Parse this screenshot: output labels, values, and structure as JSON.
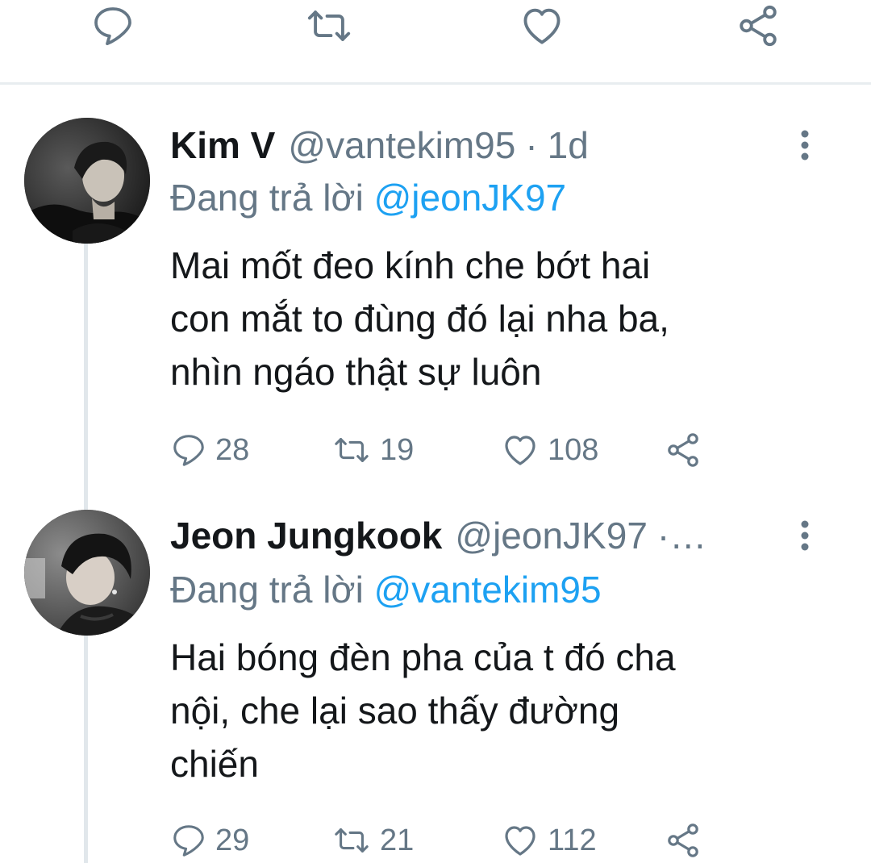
{
  "top_actions": {
    "reply_icon": "reply-icon",
    "retweet_icon": "retweet-icon",
    "like_icon": "heart-icon",
    "share_icon": "share-icon"
  },
  "tweets": [
    {
      "name": "Kim V",
      "handle": "@vantekim95",
      "separator": "·",
      "time": "1d",
      "replying_prefix": "Đang trả lời",
      "replying_to": "@jeonJK97",
      "text_lines": [
        "Mai mốt đeo kính che bớt hai",
        "con mắt to đùng đó lại nha ba,",
        "nhìn ngáo thật sự luôn"
      ],
      "replies": "28",
      "retweets": "19",
      "likes": "108"
    },
    {
      "name": "Jeon Jungkook",
      "handle": "@jeonJK97",
      "separator": "·…",
      "time": "",
      "replying_prefix": "Đang trả lời",
      "replying_to": "@vantekim95",
      "text_lines": [
        "Hai bóng đèn pha của t đó cha",
        "nội, che lại sao thấy đường",
        "chiến"
      ],
      "replies": "29",
      "retweets": "21",
      "likes": "112"
    }
  ],
  "colors": {
    "text_primary": "#14171a",
    "text_secondary": "#657786",
    "mention": "#1da1f2",
    "divider": "#e8edf0",
    "thread_line": "#e1e7eb"
  }
}
